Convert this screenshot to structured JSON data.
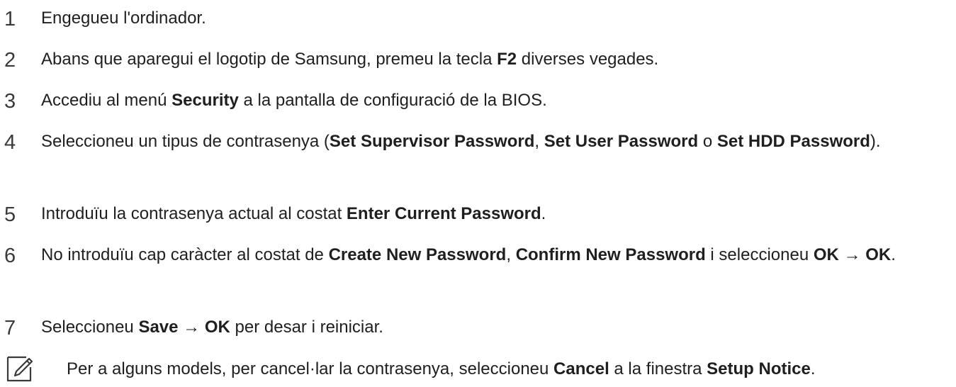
{
  "steps": [
    {
      "number": "1",
      "parts": [
        {
          "t": "Engegueu l'ordinador."
        }
      ]
    },
    {
      "number": "2",
      "parts": [
        {
          "t": "Abans que aparegui el logotip de Samsung, premeu la tecla "
        },
        {
          "t": "F2",
          "b": true
        },
        {
          "t": " diverses vegades."
        }
      ]
    },
    {
      "number": "3",
      "parts": [
        {
          "t": "Accediu al menú "
        },
        {
          "t": "Security",
          "b": true
        },
        {
          "t": " a la pantalla de configuració de la BIOS."
        }
      ]
    },
    {
      "number": "4",
      "parts": [
        {
          "t": "Seleccioneu un tipus de contrasenya ("
        },
        {
          "t": "Set Supervisor Password",
          "b": true
        },
        {
          "t": ", "
        },
        {
          "t": "Set User Password",
          "b": true
        },
        {
          "t": " o "
        },
        {
          "t": "Set HDD Password",
          "b": true
        },
        {
          "t": ")."
        }
      ]
    },
    {
      "number": "5",
      "parts": [
        {
          "t": "Introduïu la contrasenya actual al costat "
        },
        {
          "t": "Enter Current Password",
          "b": true
        },
        {
          "t": "."
        }
      ]
    },
    {
      "number": "6",
      "parts": [
        {
          "t": "No introduïu cap caràcter al costat de "
        },
        {
          "t": "Create New Password",
          "b": true
        },
        {
          "t": ", "
        },
        {
          "t": "Confirm New Password",
          "b": true
        },
        {
          "t": " i seleccioneu "
        },
        {
          "t": "OK",
          "b": true
        },
        {
          "t": " → "
        },
        {
          "t": "OK",
          "b": true
        },
        {
          "t": "."
        }
      ]
    },
    {
      "number": "7",
      "parts": [
        {
          "t": "Seleccioneu "
        },
        {
          "t": "Save",
          "b": true
        },
        {
          "t": " → "
        },
        {
          "t": "OK",
          "b": true
        },
        {
          "t": " per desar i reiniciar."
        }
      ]
    }
  ],
  "note": {
    "icon": "note-pencil-icon",
    "parts": [
      {
        "t": "Per a alguns models, per cancel·lar la contrasenya, seleccioneu "
      },
      {
        "t": "Cancel",
        "b": true
      },
      {
        "t": " a la finestra "
      },
      {
        "t": "Setup Notice",
        "b": true
      },
      {
        "t": "."
      }
    ]
  }
}
